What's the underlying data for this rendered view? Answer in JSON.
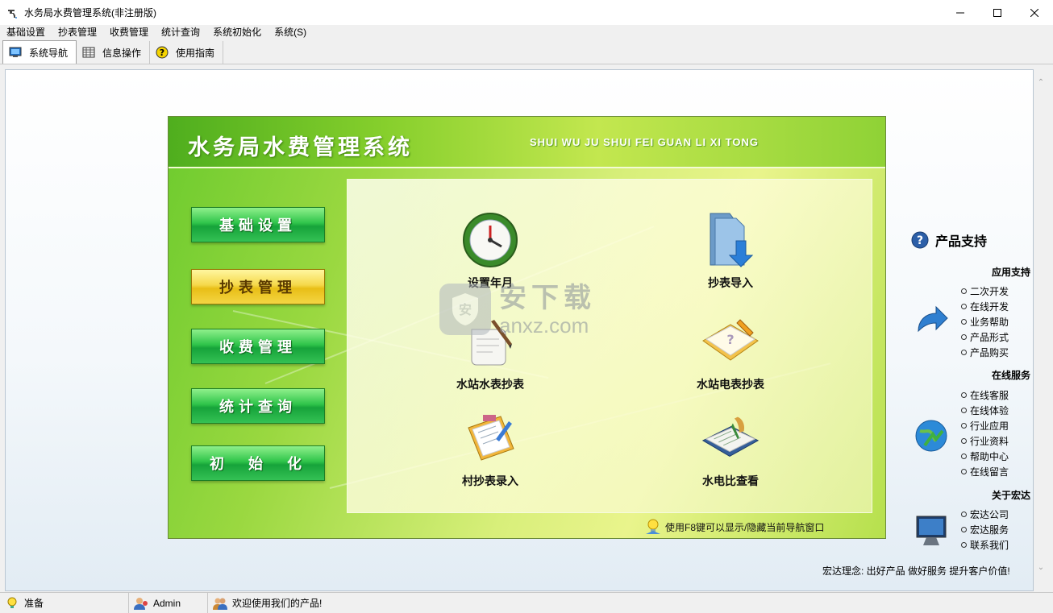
{
  "window": {
    "title": "水务局水费管理系统(非注册版)"
  },
  "menu": [
    "基础设置",
    "抄表管理",
    "收费管理",
    "统计查询",
    "系统初始化",
    "系统(S)"
  ],
  "toolbar": {
    "tabs": [
      "系统导航",
      "信息操作",
      "使用指南"
    ],
    "active": "系统导航"
  },
  "panel": {
    "title": "水务局水费管理系统",
    "subtitle": "SHUI WU JU SHUI FEI GUAN LI XI TONG",
    "nav": [
      "基础设置",
      "抄表管理",
      "收费管理",
      "统计查询",
      "初　始　化"
    ],
    "selected_nav": "抄表管理",
    "functions": [
      {
        "label": "设置年月",
        "icon": "clock-icon"
      },
      {
        "label": "抄表导入",
        "icon": "folder-import-icon"
      },
      {
        "label": "水站水表抄表",
        "icon": "scroll-quill-icon"
      },
      {
        "label": "水站电表抄表",
        "icon": "book-pen-icon"
      },
      {
        "label": "村抄表录入",
        "icon": "clipboard-icon"
      },
      {
        "label": "水电比查看",
        "icon": "ledger-icon"
      }
    ],
    "hint": "使用F8键可以显示/隐藏当前导航窗口"
  },
  "watermark": {
    "cn": "安下载",
    "en": "anxz.com"
  },
  "support": {
    "title": "产品支持",
    "sections": [
      {
        "heading": "应用支持",
        "icon": "arrow-forward-icon",
        "items": [
          "二次开发",
          "在线开发",
          "业务帮助",
          "产品形式",
          "产品购买"
        ]
      },
      {
        "heading": "在线服务",
        "icon": "globe-icon",
        "items": [
          "在线客服",
          "在线体验",
          "行业应用",
          "行业资料",
          "帮助中心",
          "在线留言"
        ]
      },
      {
        "heading": "关于宏达",
        "icon": "monitor-icon",
        "items": [
          "宏达公司",
          "宏达服务",
          "联系我们"
        ]
      }
    ],
    "motto": "宏达理念: 出好产品  做好服务  提升客户价值!"
  },
  "status": {
    "ready": "准备",
    "user": "Admin",
    "welcome": "欢迎使用我们的产品!"
  },
  "colors": {
    "panel_green": "#6dcb2e",
    "nav_green": "#16a33a",
    "nav_selected": "#e8be16"
  }
}
